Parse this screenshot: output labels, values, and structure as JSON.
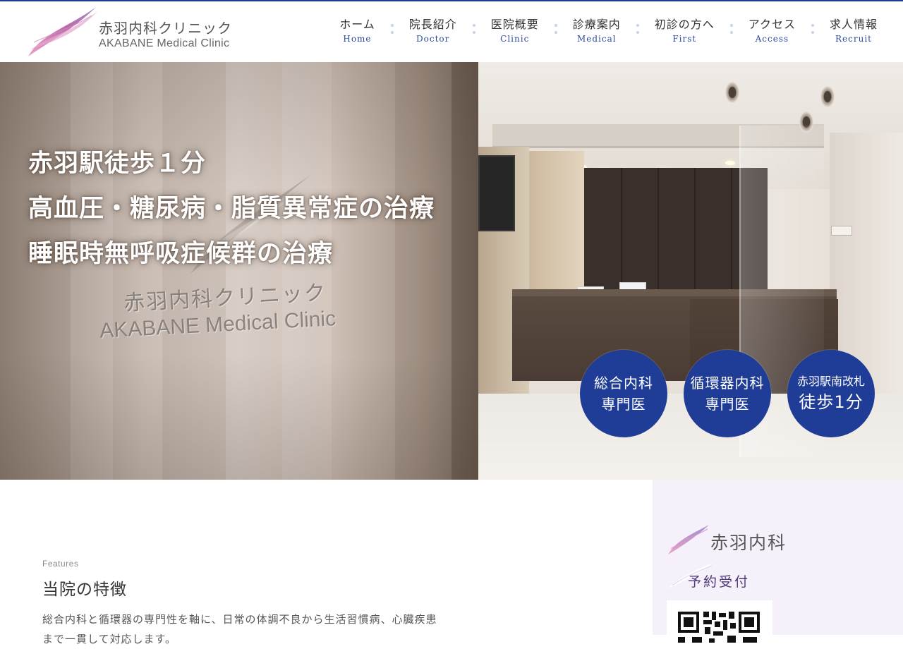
{
  "header": {
    "logo_jp": "赤羽内科クリニック",
    "logo_en": "AKABANE Medical Clinic"
  },
  "nav": [
    {
      "jp": "ホーム",
      "en": "Home"
    },
    {
      "jp": "院長紹介",
      "en": "Doctor"
    },
    {
      "jp": "医院概要",
      "en": "Clinic"
    },
    {
      "jp": "診療案内",
      "en": "Medical"
    },
    {
      "jp": "初診の方へ",
      "en": "First"
    },
    {
      "jp": "アクセス",
      "en": "Access"
    },
    {
      "jp": "求人情報",
      "en": "Recruit"
    }
  ],
  "hero": {
    "lines": [
      "赤羽駅徒歩１分",
      "高血圧・糖尿病・脂質異常症の治療",
      "睡眠時無呼吸症候群の治療"
    ],
    "wall_logo_jp": "赤羽内科クリニック",
    "wall_logo_en": "AKABANE Medical Clinic",
    "badges": [
      {
        "l1": "総合内科",
        "l2": "専門医"
      },
      {
        "l1": "循環器内科",
        "l2": "専門医"
      },
      {
        "l1": "赤羽駅南改札",
        "l2": "徒歩1分"
      }
    ]
  },
  "features": {
    "en": "Features",
    "title": "当院の特徴",
    "body": "総合内科と循環器の専門性を軸に、日常の体調不良から生活習慣病、心臓疾患まで一貫して対応します。"
  },
  "side": {
    "logo_text": "赤羽内科",
    "reserve": "予約受付"
  },
  "colors": {
    "brand_navy": "#1f3d97",
    "nav_en": "#2a4a9a",
    "side_bg": "#f6f0fb"
  }
}
